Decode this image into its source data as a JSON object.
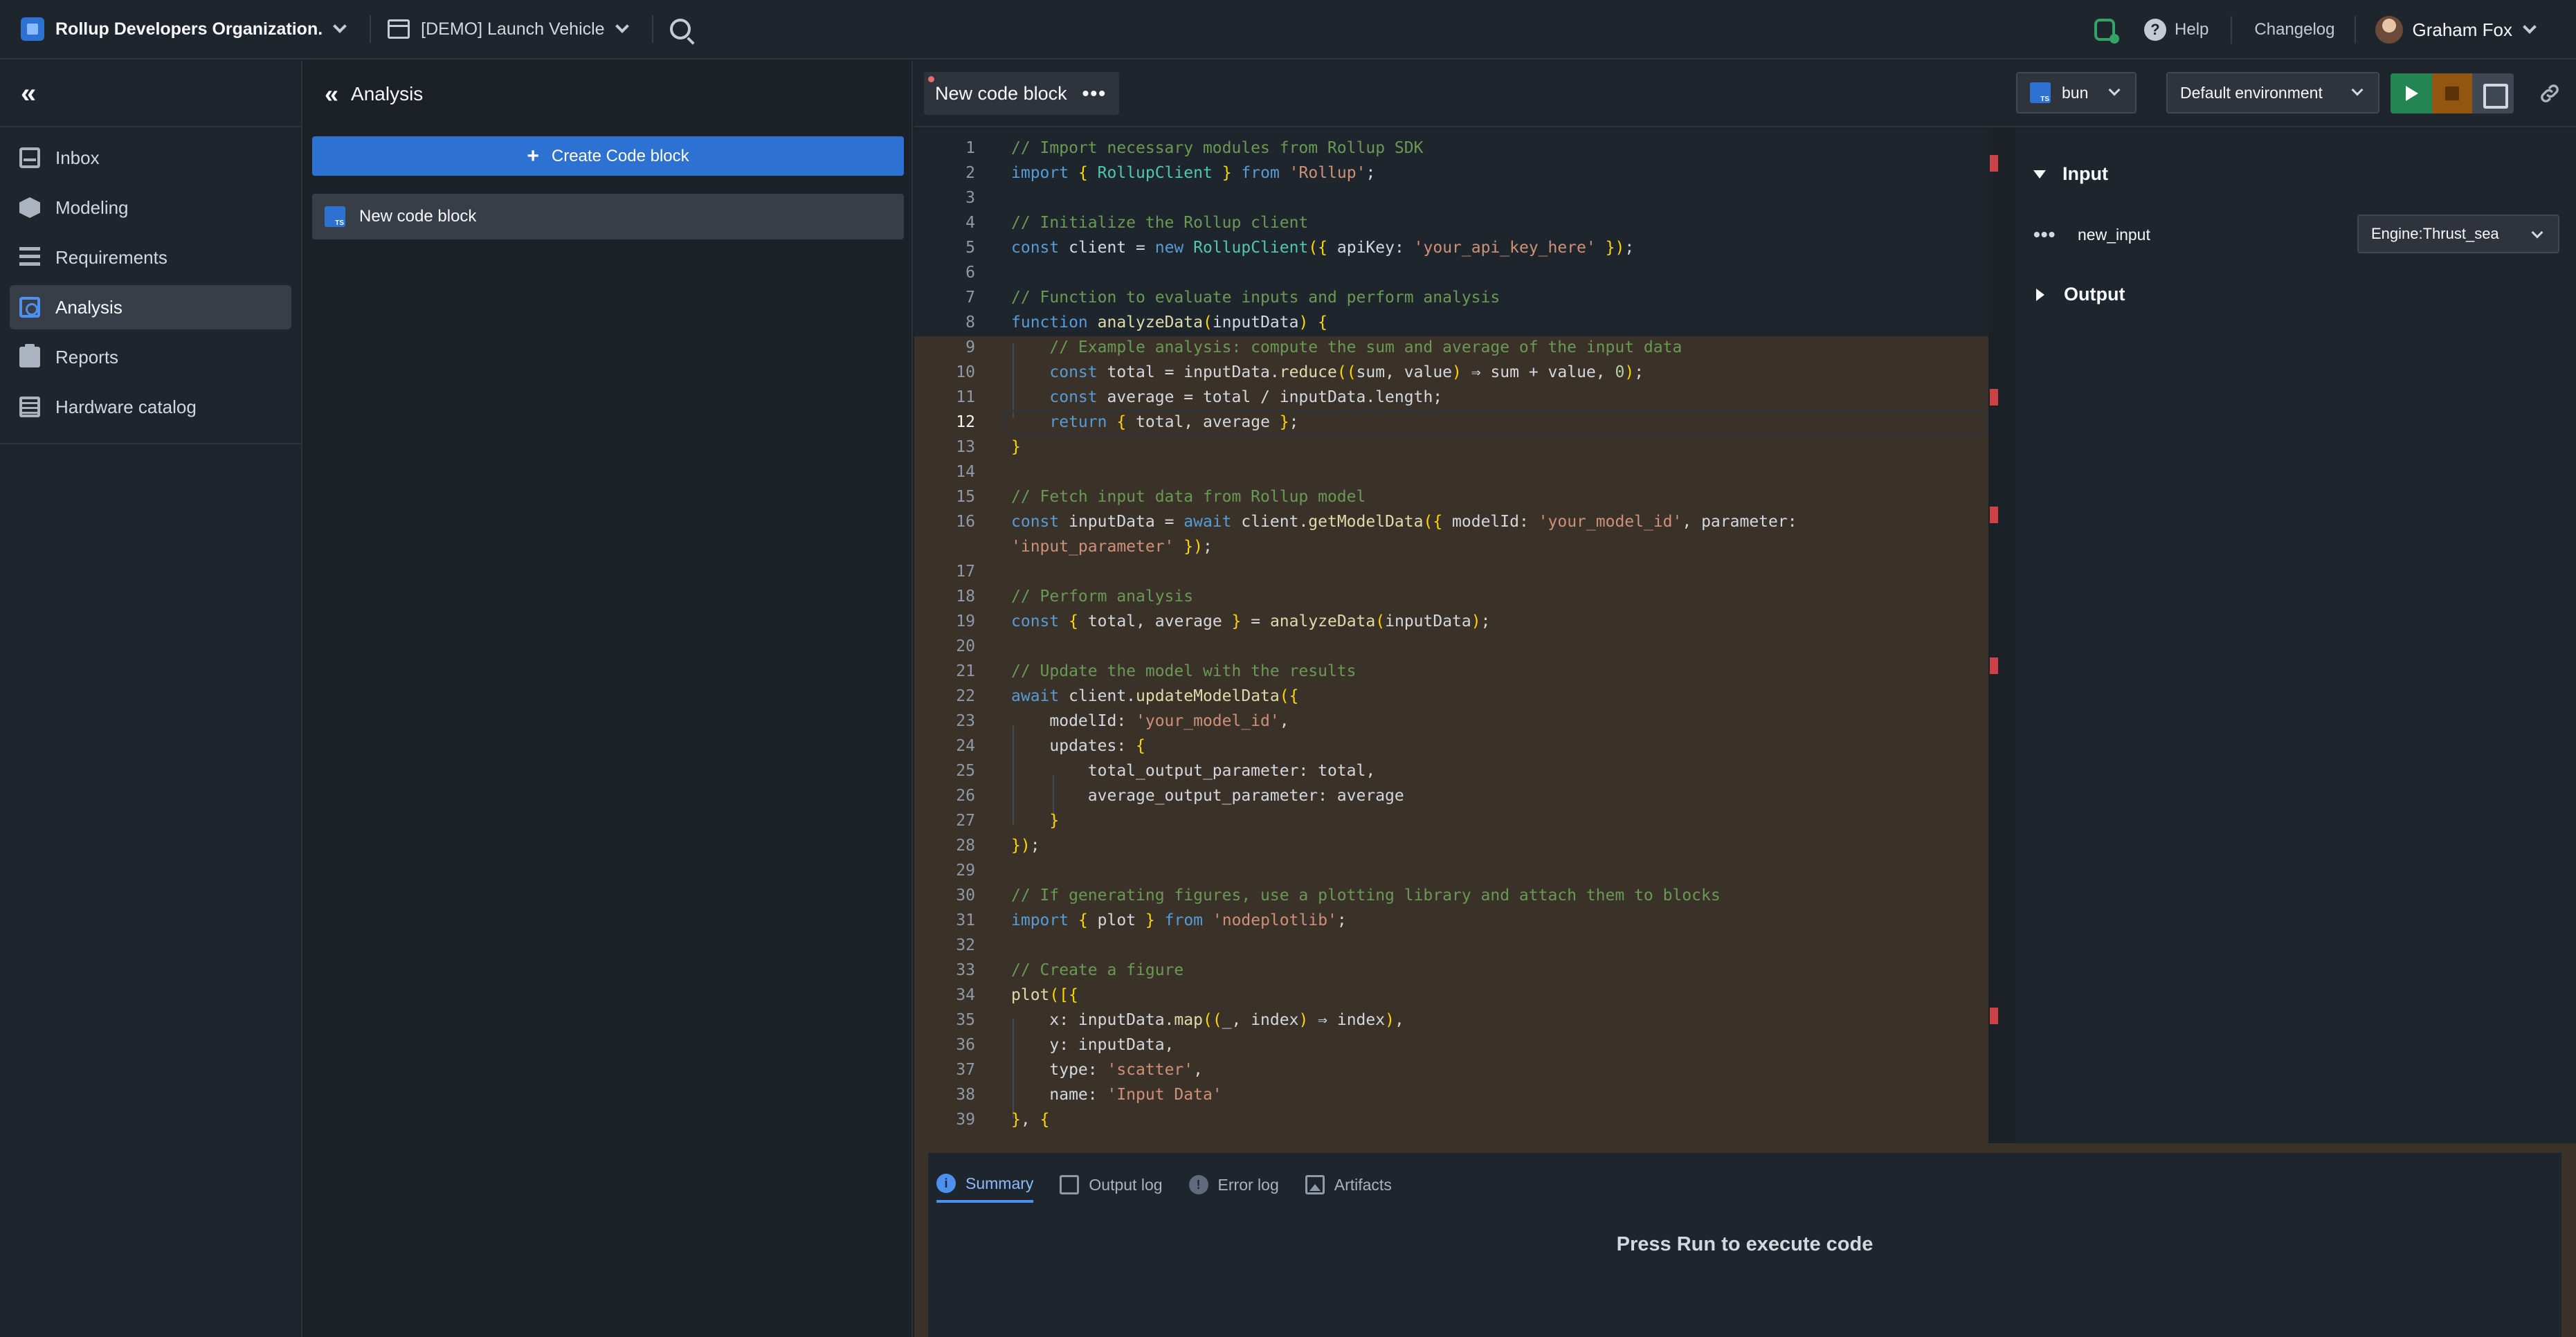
{
  "topbar": {
    "org_name": "Rollup Developers Organization.",
    "project_name": "[DEMO] Launch Vehicle",
    "help_label": "Help",
    "changelog_label": "Changelog",
    "user_name": "Graham Fox"
  },
  "nav": {
    "items": [
      {
        "label": "Inbox",
        "icon": "inbox-icon"
      },
      {
        "label": "Modeling",
        "icon": "cube-icon"
      },
      {
        "label": "Requirements",
        "icon": "requirements-icon"
      },
      {
        "label": "Analysis",
        "icon": "analysis-icon",
        "active": true
      },
      {
        "label": "Reports",
        "icon": "clipboard-icon"
      },
      {
        "label": "Hardware catalog",
        "icon": "catalog-icon"
      }
    ]
  },
  "analysis": {
    "title": "Analysis",
    "create_label": "Create Code block",
    "blocks": [
      {
        "label": "New code block"
      }
    ]
  },
  "editor": {
    "tab_label": "New code block",
    "runtime": "bun",
    "environment": "Default environment",
    "lines": [
      "// Import necessary modules from Rollup SDK",
      "import { RollupClient } from 'Rollup';",
      "",
      "// Initialize the Rollup client",
      "const client = new RollupClient({ apiKey: 'your_api_key_here' });",
      "",
      "// Function to evaluate inputs and perform analysis",
      "function analyzeData(inputData) {",
      "    // Example analysis: compute the sum and average of the input data",
      "    const total = inputData.reduce((sum, value) ⇒ sum + value, 0);",
      "    const average = total / inputData.length;",
      "    return { total, average };",
      "}",
      "",
      "// Fetch input data from Rollup model",
      "const inputData = await client.getModelData({ modelId: 'your_model_id', parameter:\n'input_parameter' });",
      "",
      "// Perform analysis",
      "const { total, average } = analyzeData(inputData);",
      "",
      "// Update the model with the results",
      "await client.updateModelData({",
      "    modelId: 'your_model_id',",
      "    updates: {",
      "        total_output_parameter: total,",
      "        average_output_parameter: average",
      "    }",
      "});",
      "",
      "// If generating figures, use a plotting library and attach them to blocks",
      "import { plot } from 'nodeplotlib';",
      "",
      "// Create a figure",
      "plot([{",
      "    x: inputData.map((_, index) ⇒ index),",
      "    y: inputData,",
      "    type: 'scatter',",
      "    name: 'Input Data'",
      "}, {"
    ],
    "current_line": 12
  },
  "sidepanel": {
    "input_section": "Input",
    "output_section": "Output",
    "input_name": "new_input",
    "input_value": "Engine:Thrust_sea"
  },
  "results": {
    "tabs": [
      "Summary",
      "Output log",
      "Error log",
      "Artifacts"
    ],
    "active_tab": "Summary",
    "message": "Press Run to execute code"
  },
  "colors": {
    "accent": "#2d72d2",
    "run": "#238551",
    "stop": "#935610",
    "error": "#cd4246"
  }
}
